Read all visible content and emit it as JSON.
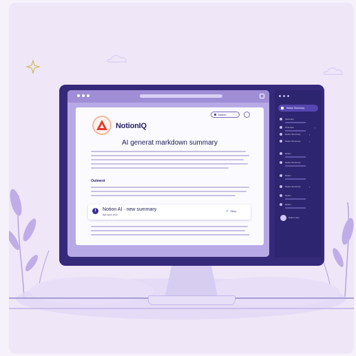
{
  "doc": {
    "brand": "NotionIQ",
    "logo_letter": "A",
    "title": "AI generat markdown summary",
    "header_button": "Notion",
    "outline_heading": "Outment",
    "callout": {
      "icon": "i",
      "title": "Notion AI · new summary",
      "subtitle": "Apt upon proc",
      "status": "Sbup"
    }
  },
  "sidebar": {
    "active_item": "Notion Summary",
    "items": [
      "Summary",
      "Overview",
      "Notion Summary",
      "Notion Summary",
      "Notion",
      "Notion Summary",
      "Notion",
      "Notion Summary",
      "Notion",
      "Notion"
    ],
    "user_label": "Notion User"
  },
  "icons": [
    "sparkle-icon",
    "cloud-icon",
    "leaf-icon",
    "info-icon",
    "check-icon"
  ],
  "colors": {
    "background": "#efe6f8",
    "monitor_frame": "#35297a",
    "screen": "#b7a9e6",
    "sidebar": "#2e2570",
    "accent": "#5546b0",
    "logo_red": "#e23b2e"
  }
}
